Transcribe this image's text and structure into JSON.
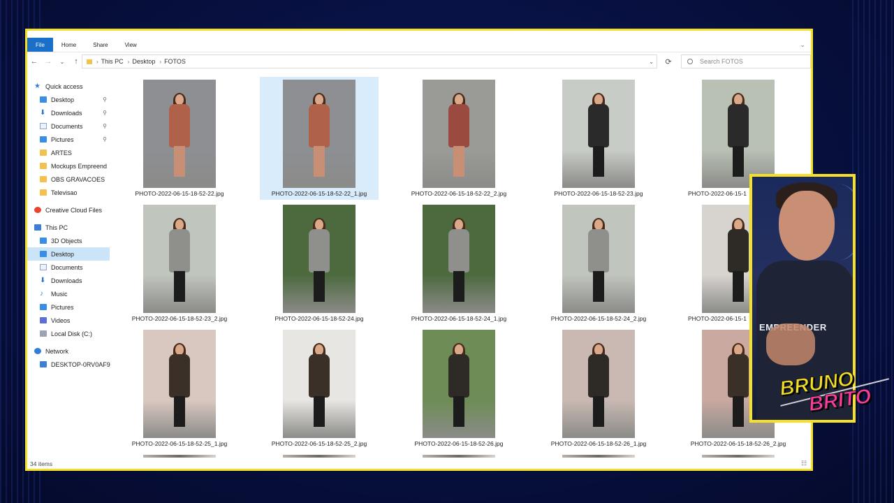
{
  "ribbon": {
    "tabs": [
      "File",
      "Home",
      "Share",
      "View"
    ]
  },
  "address": {
    "crumbs": [
      "This PC",
      "Desktop",
      "FOTOS"
    ]
  },
  "search": {
    "placeholder": "Search FOTOS"
  },
  "sidebar": {
    "items": [
      {
        "label": "Quick access",
        "icon": "star-icon",
        "level": 0
      },
      {
        "label": "Desktop",
        "icon": "desktop-icon",
        "level": 1,
        "pinned": true
      },
      {
        "label": "Downloads",
        "icon": "download-icon",
        "level": 1,
        "pinned": true
      },
      {
        "label": "Documents",
        "icon": "document-icon",
        "level": 1,
        "pinned": true
      },
      {
        "label": "Pictures",
        "icon": "pictures-icon",
        "level": 1,
        "pinned": true
      },
      {
        "label": "ARTES",
        "icon": "folder-icon",
        "level": 1
      },
      {
        "label": "Mockups Empreend",
        "icon": "folder-icon",
        "level": 1
      },
      {
        "label": "OBS GRAVACOES",
        "icon": "folder-icon",
        "level": 1
      },
      {
        "label": "Televisao",
        "icon": "folder-icon",
        "level": 1
      },
      {
        "label": "Creative Cloud Files",
        "icon": "creative-cloud-icon",
        "level": 0
      },
      {
        "label": "This PC",
        "icon": "computer-icon",
        "level": 0
      },
      {
        "label": "3D Objects",
        "icon": "3d-objects-icon",
        "level": 1
      },
      {
        "label": "Desktop",
        "icon": "desktop-icon",
        "level": 1,
        "selected": true
      },
      {
        "label": "Documents",
        "icon": "document-icon",
        "level": 1
      },
      {
        "label": "Downloads",
        "icon": "download-icon",
        "level": 1
      },
      {
        "label": "Music",
        "icon": "music-icon",
        "level": 1
      },
      {
        "label": "Pictures",
        "icon": "pictures-icon",
        "level": 1
      },
      {
        "label": "Videos",
        "icon": "videos-icon",
        "level": 1
      },
      {
        "label": "Local Disk (C:)",
        "icon": "disk-icon",
        "level": 1
      },
      {
        "label": "Network",
        "icon": "network-icon",
        "level": 0
      },
      {
        "label": "DESKTOP-0RV0AF9",
        "icon": "computer-icon",
        "level": 1
      }
    ]
  },
  "files": [
    {
      "name": "PHOTO-2022-06-15-18-52-22.jpg",
      "dress": "#b0614a",
      "bg": "#8d8f93",
      "legs": "#c98f74"
    },
    {
      "name": "PHOTO-2022-06-15-18-52-22_1.jpg",
      "dress": "#b0614a",
      "bg": "#8d8f93",
      "legs": "#c98f74",
      "selected": true
    },
    {
      "name": "PHOTO-2022-06-15-18-52-22_2.jpg",
      "dress": "#9a4a3e",
      "bg": "#9a9a96",
      "legs": "#c98f74"
    },
    {
      "name": "PHOTO-2022-06-15-18-52-23.jpg",
      "dress": "#2a2a2a",
      "bg": "#c8ccc6",
      "legs": "#1c1c1c"
    },
    {
      "name": "PHOTO-2022-06-15-18-52-23_1.jpg",
      "dress": "#2a2a2a",
      "bg": "#b9c0b4",
      "legs": "#1c1c1c"
    },
    {
      "name": "PHOTO-2022-06-15-18-52-23_2.jpg",
      "dress": "#8f8f8c",
      "bg": "#c0c5bd",
      "legs": "#1c1c1c"
    },
    {
      "name": "PHOTO-2022-06-15-18-52-24.jpg",
      "dress": "#8f8f8c",
      "bg": "#4d6a3f",
      "legs": "#1c1c1c"
    },
    {
      "name": "PHOTO-2022-06-15-18-52-24_1.jpg",
      "dress": "#8f8f8c",
      "bg": "#4d6a3f",
      "legs": "#1c1c1c"
    },
    {
      "name": "PHOTO-2022-06-15-18-52-24_2.jpg",
      "dress": "#8f8f8c",
      "bg": "#c0c5bd",
      "legs": "#1c1c1c"
    },
    {
      "name": "PHOTO-2022-06-15-18-52-25.jpg",
      "dress": "#2e2a26",
      "bg": "#d7d3cf",
      "legs": "#1c1c1c"
    },
    {
      "name": "PHOTO-2022-06-15-18-52-25_1.jpg",
      "dress": "#3a3028",
      "bg": "#d9c8c0",
      "legs": "#1c1c1c"
    },
    {
      "name": "PHOTO-2022-06-15-18-52-25_2.jpg",
      "dress": "#3a3028",
      "bg": "#e8e6e2",
      "legs": "#1c1c1c"
    },
    {
      "name": "PHOTO-2022-06-15-18-52-26.jpg",
      "dress": "#2e2a26",
      "bg": "#6d8c56",
      "legs": "#1c1c1c"
    },
    {
      "name": "PHOTO-2022-06-15-18-52-26_1.jpg",
      "dress": "#2e2a26",
      "bg": "#c9b9b2",
      "legs": "#1c1c1c"
    },
    {
      "name": "PHOTO-2022-06-15-18-52-26_2.jpg",
      "dress": "#3a3028",
      "bg": "#c9a9a0",
      "legs": "#1c1c1c"
    }
  ],
  "visible_names": {
    "r0c4": "PHOTO-2022-06-15-1",
    "r1c4": "PHOTO-2022-06-15-1"
  },
  "status": {
    "item_count": "34 items"
  },
  "webcam": {
    "shirt_text": "EMPREENDER"
  },
  "logo": {
    "line1": "BRUNO",
    "line2": "BRITO"
  },
  "colors": {
    "window_border": "#f4e026",
    "accent": "#1a6fc8",
    "selection": "#cce4f7",
    "logo_pink": "#ff3aa0"
  }
}
